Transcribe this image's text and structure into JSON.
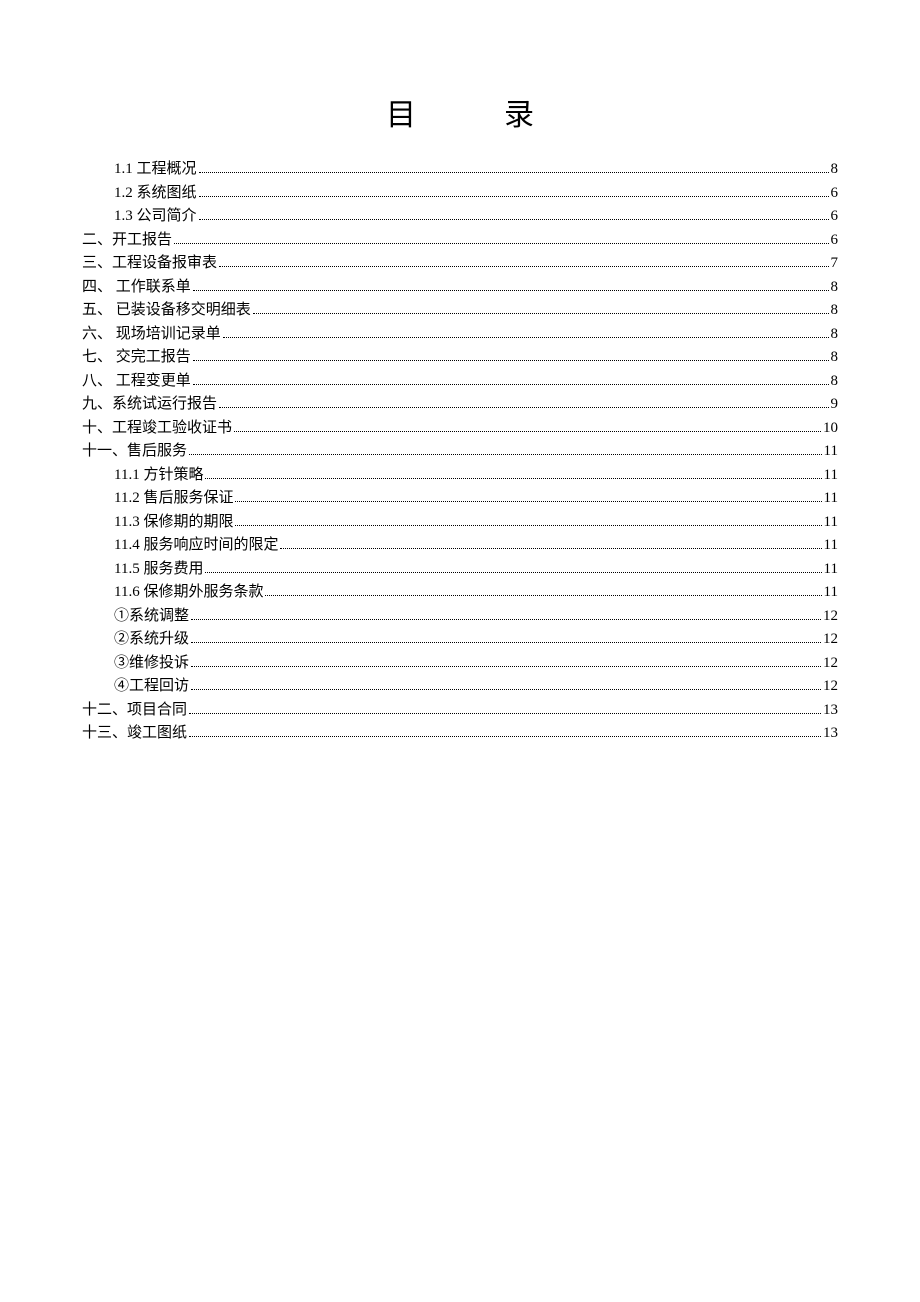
{
  "title_left": "目",
  "title_right": "录",
  "toc": [
    {
      "label": "1.1 工程概况",
      "page": "8",
      "indent": 1
    },
    {
      "label": "1.2 系统图纸",
      "page": "6",
      "indent": 1
    },
    {
      "label": "1.3 公司简介",
      "page": "6",
      "indent": 1
    },
    {
      "label": "二、开工报告",
      "page": "6",
      "indent": 0
    },
    {
      "label": "三、工程设备报审表",
      "page": "7",
      "indent": 0
    },
    {
      "label": "四、 工作联系单",
      "page": "8",
      "indent": 0
    },
    {
      "label": "五、 已装设备移交明细表",
      "page": "8",
      "indent": 0
    },
    {
      "label": "六、 现场培训记录单",
      "page": "8",
      "indent": 0
    },
    {
      "label": "七、 交完工报告",
      "page": "8",
      "indent": 0
    },
    {
      "label": "八、 工程变更单",
      "page": "8",
      "indent": 0
    },
    {
      "label": "九、系统试运行报告",
      "page": "9",
      "indent": 0
    },
    {
      "label": "十、工程竣工验收证书",
      "page": "10",
      "indent": 0
    },
    {
      "label": "十一、售后服务",
      "page": "11",
      "indent": 0
    },
    {
      "label": "11.1 方针策略",
      "page": "11",
      "indent": 1
    },
    {
      "label": "11.2 售后服务保证",
      "page": "11",
      "indent": 1
    },
    {
      "label": "11.3 保修期的期限",
      "page": "11",
      "indent": 1
    },
    {
      "label": "11.4 服务响应时间的限定",
      "page": "11",
      "indent": 1
    },
    {
      "label": "11.5 服务费用",
      "page": "11",
      "indent": 1
    },
    {
      "label": "11.6 保修期外服务条款",
      "page": "11",
      "indent": 1
    },
    {
      "label": "①系统调整",
      "page": "12",
      "indent": 1
    },
    {
      "label": "②系统升级",
      "page": "12",
      "indent": 1
    },
    {
      "label": "③维修投诉",
      "page": "12",
      "indent": 1
    },
    {
      "label": "④工程回访",
      "page": "12",
      "indent": 1
    },
    {
      "label": "十二、项目合同",
      "page": "13",
      "indent": 0
    },
    {
      "label": "十三、竣工图纸",
      "page": "13",
      "indent": 0
    }
  ]
}
